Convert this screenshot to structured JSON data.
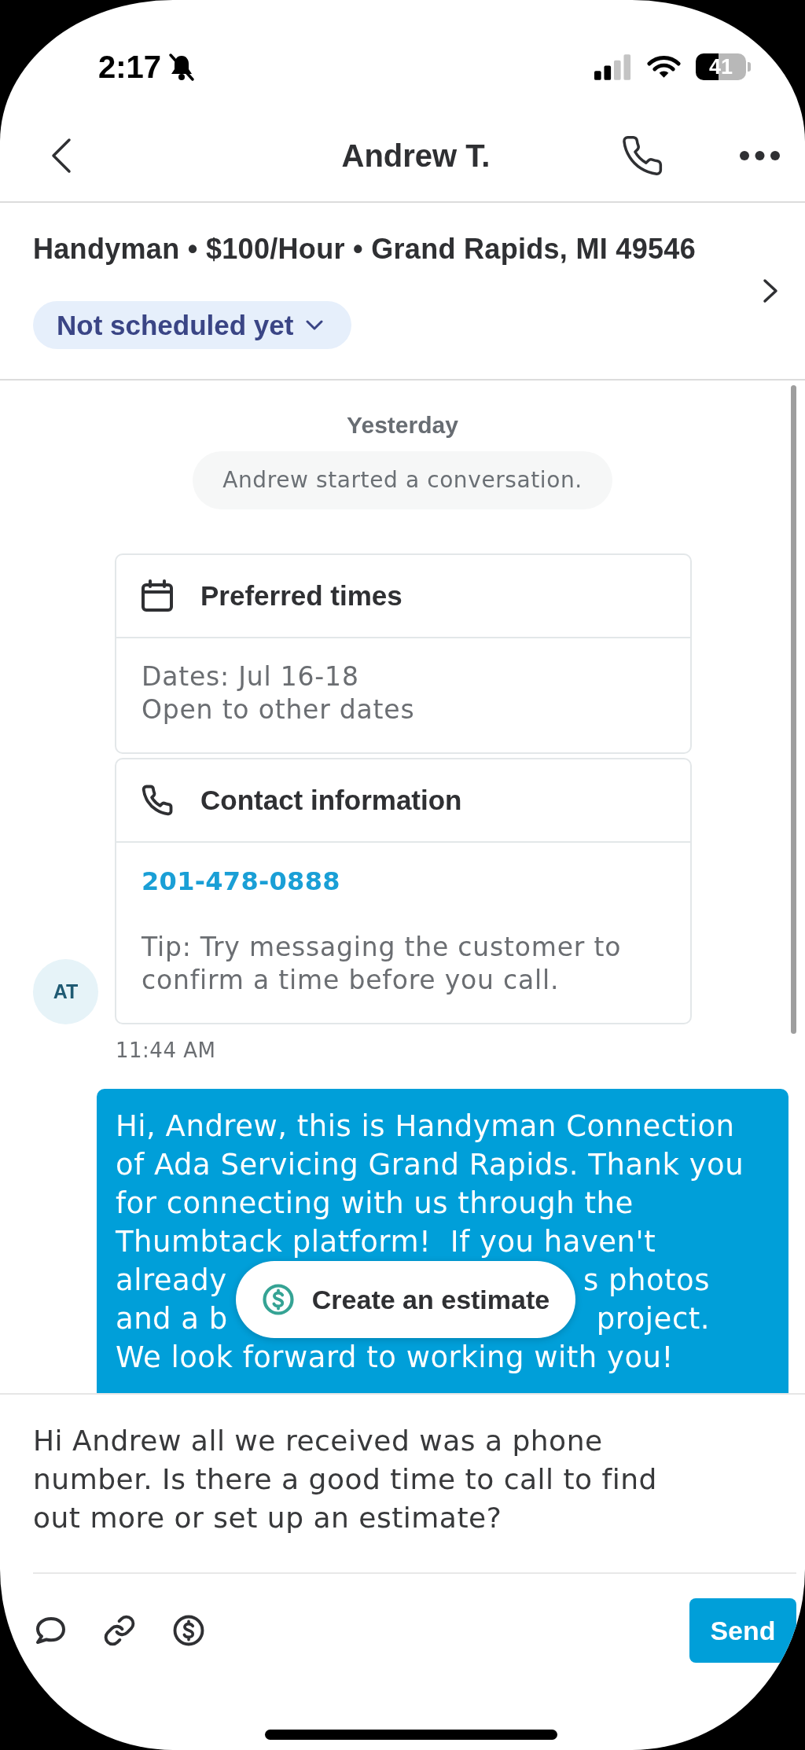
{
  "status_bar": {
    "time": "2:17",
    "battery": "41"
  },
  "header": {
    "title": "Andrew T."
  },
  "job": {
    "summary": "Handyman • $100/Hour • Grand Rapids, MI 49546",
    "schedule_status": "Not scheduled yet"
  },
  "conversation": {
    "day_label": "Yesterday",
    "system_note": "Andrew started a conversation.",
    "sender_initials": "AT",
    "cards": [
      {
        "kind": "schedule",
        "title": "Preferred times",
        "items": [
          {
            "kind": "text",
            "text": "Dates: Jul 16-18"
          },
          {
            "kind": "text",
            "text": "Open to other dates"
          }
        ]
      },
      {
        "kind": "contact",
        "title": "Contact information",
        "items": [
          {
            "kind": "link",
            "text": "201-478-0888"
          },
          {
            "kind": "tip",
            "text": "Tip: Try messaging the customer to confirm a time before you call."
          }
        ]
      }
    ],
    "timestamp": "11:44 AM",
    "outgoing_message": {
      "text_above": "Hi, Andrew, this is Handyman Connection\nof Ada Servicing Grand Rapids. Thank you\nfor connecting with us through the\nThumbtack platform!  If you haven't",
      "covered_lines": [
        {
          "left": "already",
          "right": "s photos"
        },
        {
          "left": "and a b",
          "right": "project."
        }
      ],
      "text_below": "We look forward to working with you!"
    },
    "estimate_button": {
      "label": "Create an estimate"
    }
  },
  "composer": {
    "value": "Hi Andrew all we received was a phone number. Is there a good time to call to find out more or set up an estimate?",
    "send_label": "Send"
  }
}
